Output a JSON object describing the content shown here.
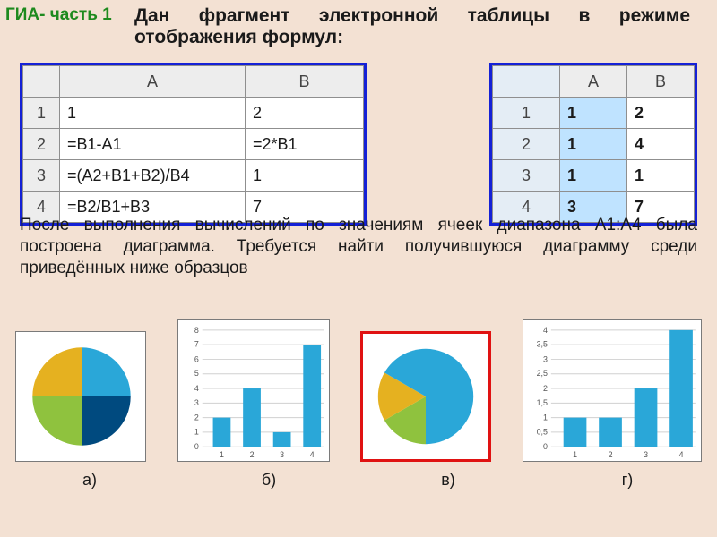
{
  "header": {
    "gia": "ГИА- часть 1",
    "title": "Дан фрагмент электронной таблицы в режиме отображения формул:"
  },
  "formula_table": {
    "cols": [
      "A",
      "B"
    ],
    "rows": [
      {
        "n": "1",
        "A": "1",
        "B": "2"
      },
      {
        "n": "2",
        "A": "=B1-A1",
        "B": "=2*B1"
      },
      {
        "n": "3",
        "A": "=(A2+B1+B2)/B4",
        "B": "1"
      },
      {
        "n": "4",
        "A": "=B2/B1+B3",
        "B": "7"
      }
    ]
  },
  "values_table": {
    "cols": [
      "A",
      "B"
    ],
    "rows": [
      {
        "n": "1",
        "A": "1",
        "B": "2"
      },
      {
        "n": "2",
        "A": "1",
        "B": "4"
      },
      {
        "n": "3",
        "A": "1",
        "B": "1"
      },
      {
        "n": "4",
        "A": "3",
        "B": "7"
      }
    ]
  },
  "paragraph": "После выполнения вычислений по значениям ячеек диапазона A1:A4 была построена диаграмма. Требуется найти получившуюся диаграмму среди приведённых ниже образцов",
  "options": {
    "a": "а)",
    "b": "б)",
    "c": "в)",
    "d": "г)"
  },
  "chart_data": [
    {
      "id": "a",
      "type": "pie",
      "label": "а)",
      "categories": [
        "1",
        "2",
        "3",
        "4"
      ],
      "values": [
        1,
        1,
        1,
        1
      ],
      "colors": [
        "#2aa7d8",
        "#8fc23e",
        "#e5b120",
        "#004a7f"
      ]
    },
    {
      "id": "b",
      "type": "bar",
      "label": "б)",
      "categories": [
        "1",
        "2",
        "3",
        "4"
      ],
      "values": [
        2,
        4,
        1,
        7
      ],
      "ylim": [
        0,
        8
      ],
      "yticks": [
        0,
        1,
        2,
        3,
        4,
        5,
        6,
        7,
        8
      ],
      "color": "#2aa7d8"
    },
    {
      "id": "c",
      "type": "pie",
      "label": "в)",
      "answer": true,
      "categories": [
        "1",
        "2",
        "3",
        "4"
      ],
      "values": [
        1,
        1,
        1,
        3
      ],
      "colors": [
        "#e5b120",
        "#8fc23e",
        "#2aa7d8",
        "#2aa7d8"
      ]
    },
    {
      "id": "d",
      "type": "bar",
      "label": "г)",
      "categories": [
        "1",
        "2",
        "3",
        "4"
      ],
      "values": [
        1,
        1,
        2,
        4
      ],
      "ylim": [
        0,
        4.5
      ],
      "yticks": [
        0,
        0.5,
        1,
        1.5,
        2,
        2.5,
        3,
        3.5,
        4
      ],
      "color": "#2aa7d8"
    }
  ]
}
